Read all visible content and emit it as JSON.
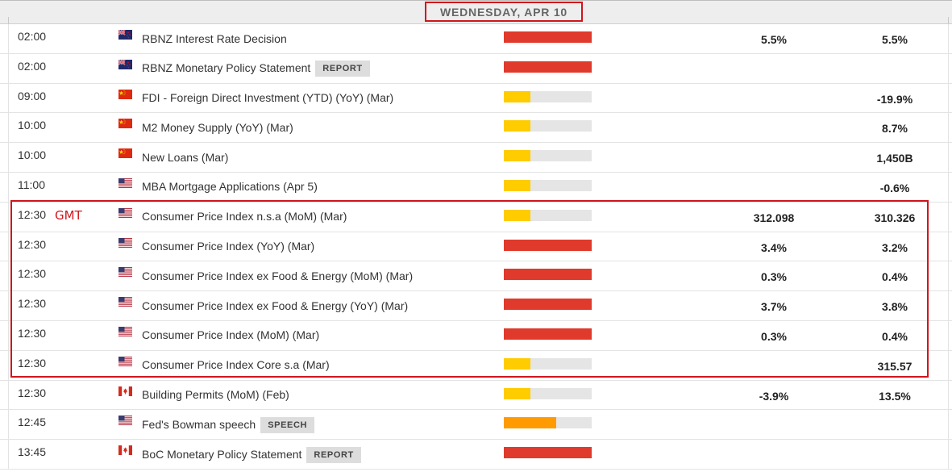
{
  "calendar": {
    "date_header": "WEDNESDAY, APR 10",
    "gmt_annotation": "GMT",
    "colors": {
      "high": "#e03a2c",
      "medium": "#ff9b00",
      "low": "#ffcc00",
      "empty": "#e5e5e5",
      "highlight": "#d0161b"
    },
    "rows": [
      {
        "time": "02:00",
        "flag": "nz-flag-icon",
        "event": "RBNZ Interest Rate Decision",
        "tag": "",
        "impact": 1.0,
        "level": "high",
        "val1": "5.5%",
        "val2": "5.5%"
      },
      {
        "time": "02:00",
        "flag": "nz-flag-icon",
        "event": "RBNZ Monetary Policy Statement",
        "tag": "REPORT",
        "impact": 1.0,
        "level": "high",
        "val1": "",
        "val2": ""
      },
      {
        "time": "09:00",
        "flag": "cn-flag-icon",
        "event": "FDI - Foreign Direct Investment (YTD) (YoY) (Mar)",
        "tag": "",
        "impact": 0.3,
        "level": "low",
        "val1": "",
        "val2": "-19.9%"
      },
      {
        "time": "10:00",
        "flag": "cn-flag-icon",
        "event": "M2 Money Supply (YoY) (Mar)",
        "tag": "",
        "impact": 0.3,
        "level": "low",
        "val1": "",
        "val2": "8.7%"
      },
      {
        "time": "10:00",
        "flag": "cn-flag-icon",
        "event": "New Loans (Mar)",
        "tag": "",
        "impact": 0.3,
        "level": "low",
        "val1": "",
        "val2": "1,450B"
      },
      {
        "time": "11:00",
        "flag": "us-flag-icon",
        "event": "MBA Mortgage Applications (Apr 5)",
        "tag": "",
        "impact": 0.3,
        "level": "low",
        "val1": "",
        "val2": "-0.6%"
      },
      {
        "time": "12:30",
        "flag": "us-flag-icon",
        "event": "Consumer Price Index n.s.a (MoM) (Mar)",
        "tag": "",
        "impact": 0.3,
        "level": "low",
        "val1": "312.098",
        "val2": "310.326"
      },
      {
        "time": "12:30",
        "flag": "us-flag-icon",
        "event": "Consumer Price Index (YoY) (Mar)",
        "tag": "",
        "impact": 1.0,
        "level": "high",
        "val1": "3.4%",
        "val2": "3.2%"
      },
      {
        "time": "12:30",
        "flag": "us-flag-icon",
        "event": "Consumer Price Index ex Food & Energy (MoM) (Mar)",
        "tag": "",
        "impact": 1.0,
        "level": "high",
        "val1": "0.3%",
        "val2": "0.4%"
      },
      {
        "time": "12:30",
        "flag": "us-flag-icon",
        "event": "Consumer Price Index ex Food & Energy (YoY) (Mar)",
        "tag": "",
        "impact": 1.0,
        "level": "high",
        "val1": "3.7%",
        "val2": "3.8%"
      },
      {
        "time": "12:30",
        "flag": "us-flag-icon",
        "event": "Consumer Price Index (MoM) (Mar)",
        "tag": "",
        "impact": 1.0,
        "level": "high",
        "val1": "0.3%",
        "val2": "0.4%"
      },
      {
        "time": "12:30",
        "flag": "us-flag-icon",
        "event": "Consumer Price Index Core s.a (Mar)",
        "tag": "",
        "impact": 0.3,
        "level": "low",
        "val1": "",
        "val2": "315.57"
      },
      {
        "time": "12:30",
        "flag": "ca-flag-icon",
        "event": "Building Permits (MoM) (Feb)",
        "tag": "",
        "impact": 0.3,
        "level": "low",
        "val1": "-3.9%",
        "val2": "13.5%"
      },
      {
        "time": "12:45",
        "flag": "us-flag-icon",
        "event": "Fed's Bowman speech",
        "tag": "SPEECH",
        "impact": 0.6,
        "level": "medium",
        "val1": "",
        "val2": ""
      },
      {
        "time": "13:45",
        "flag": "ca-flag-icon",
        "event": "BoC Monetary Policy Statement",
        "tag": "REPORT",
        "impact": 1.0,
        "level": "high",
        "val1": "",
        "val2": ""
      }
    ]
  }
}
